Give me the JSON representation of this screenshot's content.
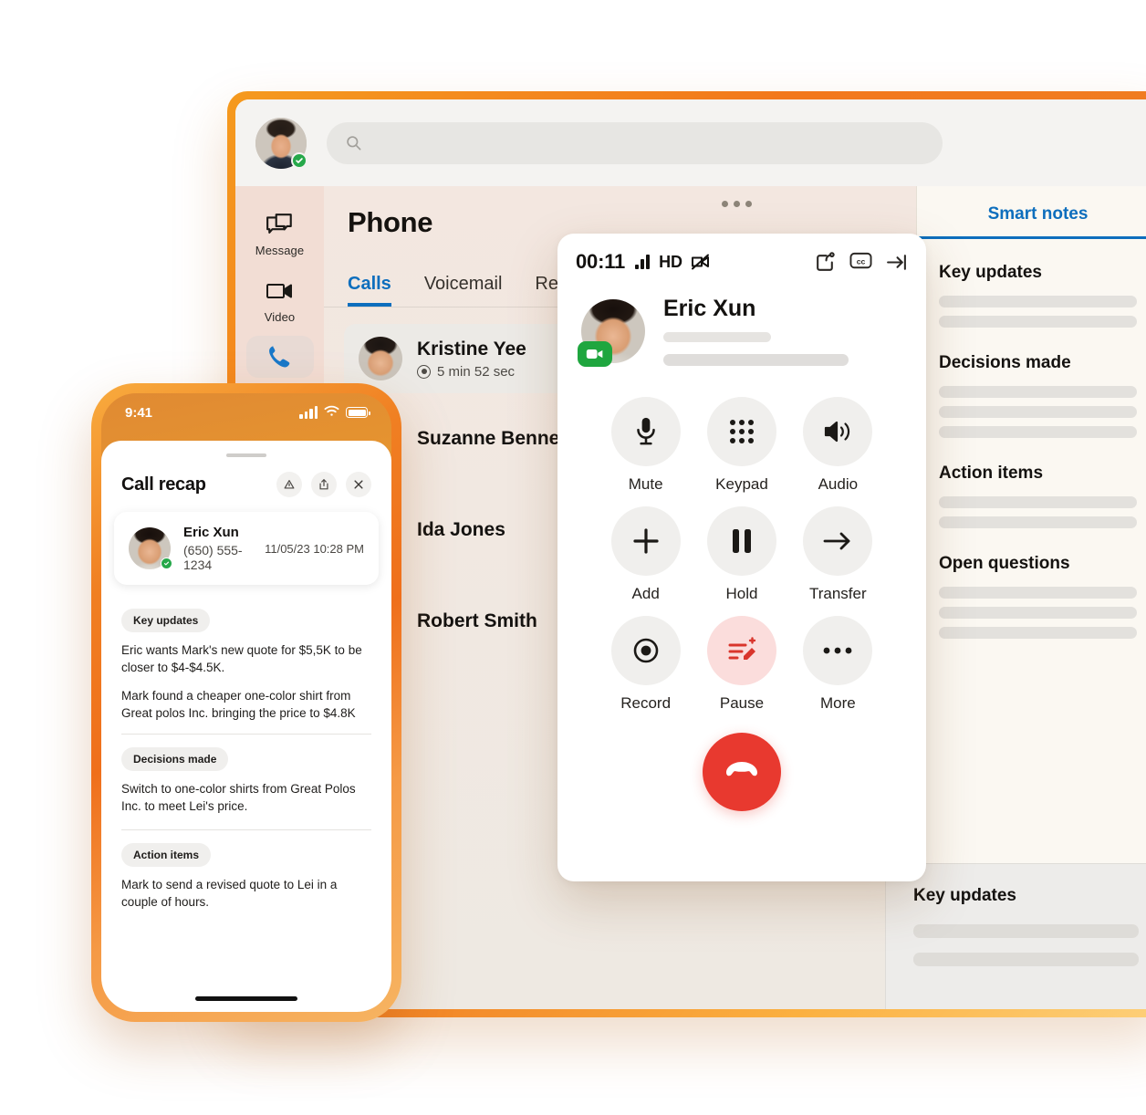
{
  "desktop": {
    "search": {
      "placeholder": "",
      "value": "",
      "icon": "search-icon"
    },
    "avatar_status": "available",
    "rail": [
      {
        "label": "Message",
        "icon": "message-icon",
        "active": false
      },
      {
        "label": "Video",
        "icon": "video-camera-icon",
        "active": false
      },
      {
        "label": "",
        "icon": "phone-icon",
        "active": true
      }
    ],
    "page_title": "Phone",
    "overflow_menu": "…",
    "tabs": [
      {
        "label": "Calls",
        "active": true
      },
      {
        "label": "Voicemail",
        "active": false
      },
      {
        "label": "Rec",
        "active": false
      }
    ],
    "calls": [
      {
        "name": "Kristine Yee",
        "duration": "5 min 52 sec",
        "active": true
      },
      {
        "name": "Suzanne Bennett",
        "duration": "",
        "active": false
      },
      {
        "name": "Ida Jones",
        "duration": "",
        "active": false
      },
      {
        "name": "Robert Smith",
        "duration": "",
        "active": false
      }
    ],
    "notes_panel": {
      "tab_label": "Smart notes",
      "sections": [
        {
          "heading": "Key updates",
          "lines": 2
        },
        {
          "heading": "Decisions made",
          "lines": 3
        },
        {
          "heading": "Action items",
          "lines": 2
        },
        {
          "heading": "Open questions",
          "lines": 3
        }
      ]
    },
    "lower_panel": {
      "heading": "Key updates",
      "lines": 2
    }
  },
  "call_window": {
    "timer": "00:11",
    "quality_label": "HD",
    "signal_icon": "signal-bars-icon",
    "video_off_icon": "video-off-icon",
    "header_actions": [
      {
        "name": "share-screen-icon",
        "label": "Share"
      },
      {
        "name": "closed-captions-icon",
        "label": "CC"
      },
      {
        "name": "collapse-right-icon",
        "label": "Collapse"
      }
    ],
    "participant": {
      "name": "Eric Xun",
      "video_badge": "video-on-badge"
    },
    "controls": [
      {
        "label": "Mute",
        "icon": "microphone-icon",
        "highlighted": false
      },
      {
        "label": "Keypad",
        "icon": "keypad-icon",
        "highlighted": false
      },
      {
        "label": "Audio",
        "icon": "speaker-icon",
        "highlighted": false
      },
      {
        "label": "Add",
        "icon": "plus-icon",
        "highlighted": false
      },
      {
        "label": "Hold",
        "icon": "pause-icon",
        "highlighted": false
      },
      {
        "label": "Transfer",
        "icon": "arrow-right-icon",
        "highlighted": false
      },
      {
        "label": "Record",
        "icon": "record-icon",
        "highlighted": false
      },
      {
        "label": "Pause",
        "icon": "smart-notes-pause-icon",
        "highlighted": true
      },
      {
        "label": "More",
        "icon": "ellipsis-icon",
        "highlighted": false
      }
    ],
    "end_call": {
      "label": "End call",
      "icon": "end-call-icon",
      "color": "#e8392f"
    }
  },
  "phone": {
    "status_bar": {
      "time": "9:41",
      "signal": "signal-bars-icon",
      "wifi": "wifi-icon",
      "battery": "battery-icon"
    },
    "sheet": {
      "title": "Call recap",
      "actions": [
        {
          "name": "flag-icon"
        },
        {
          "name": "share-icon"
        },
        {
          "name": "close-icon"
        }
      ],
      "contact": {
        "name": "Eric Xun",
        "phone": "(650) 555-1234",
        "datetime": "11/05/23 10:28 PM"
      },
      "sections": [
        {
          "chip": "Key updates",
          "paragraphs": [
            "Eric wants Mark's new quote for $5,5K to be closer to $4-$4.5K.",
            "Mark found a cheaper one-color shirt from Great polos Inc. bringing the price to $4.8K"
          ]
        },
        {
          "chip": "Decisions made",
          "paragraphs": [
            "Switch to one-color shirts from Great Polos Inc. to meet Lei's price."
          ]
        },
        {
          "chip": "Action items",
          "paragraphs": [
            "Mark to send a revised quote to Lei in a couple of hours."
          ]
        }
      ]
    }
  },
  "colors": {
    "accent_blue": "#0d6ebd",
    "end_call_red": "#e8392f",
    "pause_pink": "#fbdddc",
    "presence_green": "#26a84a",
    "frame_orange": "#f07f22"
  }
}
